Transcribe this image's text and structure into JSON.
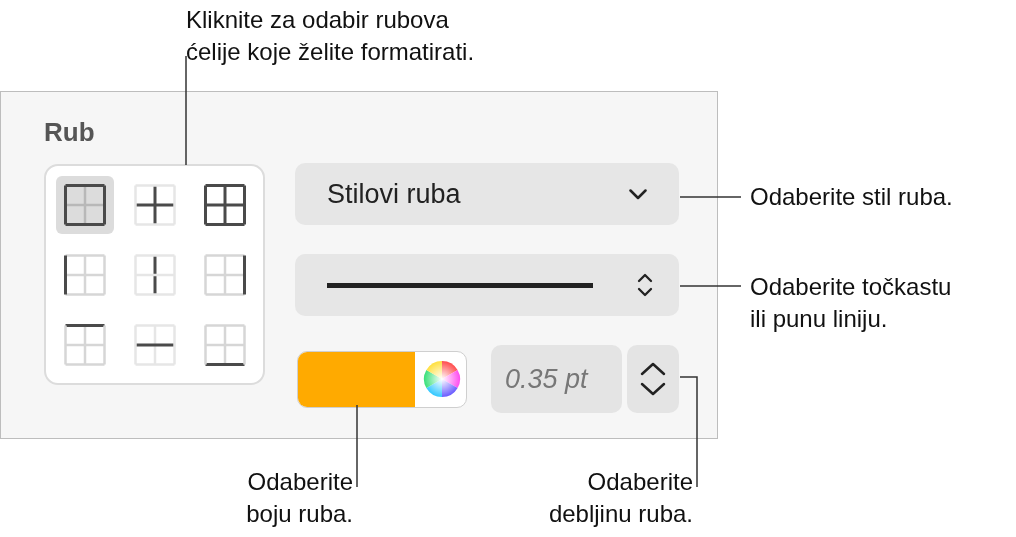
{
  "panel": {
    "title": "Rub",
    "border_options": [
      {
        "kind": "outer",
        "selected": true
      },
      {
        "kind": "inner",
        "selected": false
      },
      {
        "kind": "all",
        "selected": false
      },
      {
        "kind": "left",
        "selected": false
      },
      {
        "kind": "vertical",
        "selected": false
      },
      {
        "kind": "right",
        "selected": false
      },
      {
        "kind": "top",
        "selected": false
      },
      {
        "kind": "horizontal",
        "selected": false
      },
      {
        "kind": "bottom",
        "selected": false
      }
    ],
    "style_dropdown": {
      "label": "Stilovi ruba"
    },
    "line_style": {
      "kind": "solid"
    },
    "color_well": {
      "color": "#ffaa00"
    },
    "width_field": {
      "value": "0.35 pt"
    }
  },
  "callouts": [
    {
      "kind": "top",
      "lines": [
        "Kliknite za odabir rubova",
        "ćelije koje želite formatirati."
      ]
    },
    {
      "kind": "style",
      "lines": [
        "Odaberite stil ruba."
      ]
    },
    {
      "kind": "line",
      "lines": [
        "Odaberite točkastu",
        "ili punu liniju."
      ]
    },
    {
      "kind": "color",
      "lines": [
        "Odaberite",
        "boju ruba."
      ]
    },
    {
      "kind": "width",
      "lines": [
        "Odaberite",
        "debljinu ruba."
      ]
    }
  ]
}
